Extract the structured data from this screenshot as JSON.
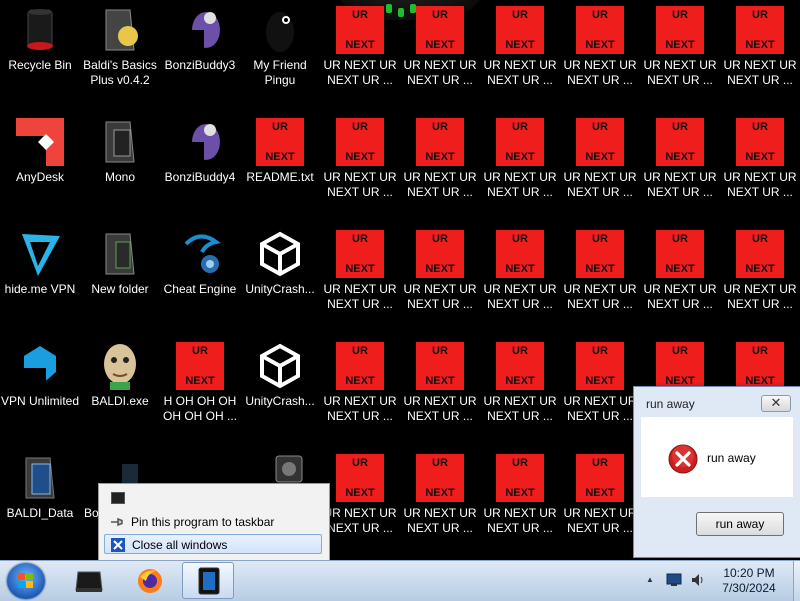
{
  "desktop": {
    "icons": [
      {
        "label": "Recycle Bin",
        "icon": "recycle-bin-icon"
      },
      {
        "label": "Baldi's Basics Plus v0.4.2",
        "icon": "folder-icon"
      },
      {
        "label": "BonziBuddy3",
        "icon": "bonzibuddy-icon"
      },
      {
        "label": "My Friend Pingu",
        "icon": "penguin-icon"
      },
      {
        "label": "AnyDesk",
        "icon": "anydesk-icon"
      },
      {
        "label": "Mono",
        "icon": "folder-icon"
      },
      {
        "label": "BonziBuddy4",
        "icon": "bonzibuddy-icon"
      },
      {
        "label": "README.txt",
        "icon": "ur-next-icon"
      },
      {
        "label": "hide.me VPN",
        "icon": "vpn-icon"
      },
      {
        "label": "New folder",
        "icon": "folder-icon"
      },
      {
        "label": "Cheat Engine",
        "icon": "cheat-engine-icon"
      },
      {
        "label": "UnityCrash...",
        "icon": "unity-icon"
      },
      {
        "label": "VPN Unlimited",
        "icon": "vpn-shield-icon"
      },
      {
        "label": "BALDI.exe",
        "icon": "baldi-head-icon"
      },
      {
        "label": "H OH OH OH OH OH OH ...",
        "icon": "ur-next-icon"
      },
      {
        "label": "UnityCrash...",
        "icon": "unity-icon"
      },
      {
        "label": "BALDI_Data",
        "icon": "folder-icon"
      },
      {
        "label": "Bo",
        "icon": "bonzibuddy-icon"
      }
    ],
    "ur_icon_text_top": "UR",
    "ur_icon_text_bottom": "NEXT",
    "ur_icon_label": "UR NEXT UR NEXT UR ..."
  },
  "jumplist": {
    "items": [
      {
        "label": "Pin this program to taskbar",
        "icon": "pin-icon"
      },
      {
        "label": "Close all windows",
        "icon": "close-window-icon"
      }
    ]
  },
  "dialog": {
    "title": "run away",
    "close_glyph": "✕",
    "message": "run away",
    "button_label": "run away",
    "icon": "error-icon"
  },
  "taskbar": {
    "items": [
      {
        "icon": "start-orb-icon"
      },
      {
        "icon": "black-window-icon"
      },
      {
        "icon": "firefox-icon"
      },
      {
        "icon": "app-window-icon"
      }
    ],
    "tray_up_arrow": "▲",
    "clock_time": "10:20 PM",
    "clock_date": "7/30/2024"
  },
  "colors": {
    "desktop_bg": "#000000",
    "ur_icon_bg": "#f01d1d",
    "taskbar_top": "#dfe9f5",
    "taskbar_bottom": "#b7cce4"
  }
}
